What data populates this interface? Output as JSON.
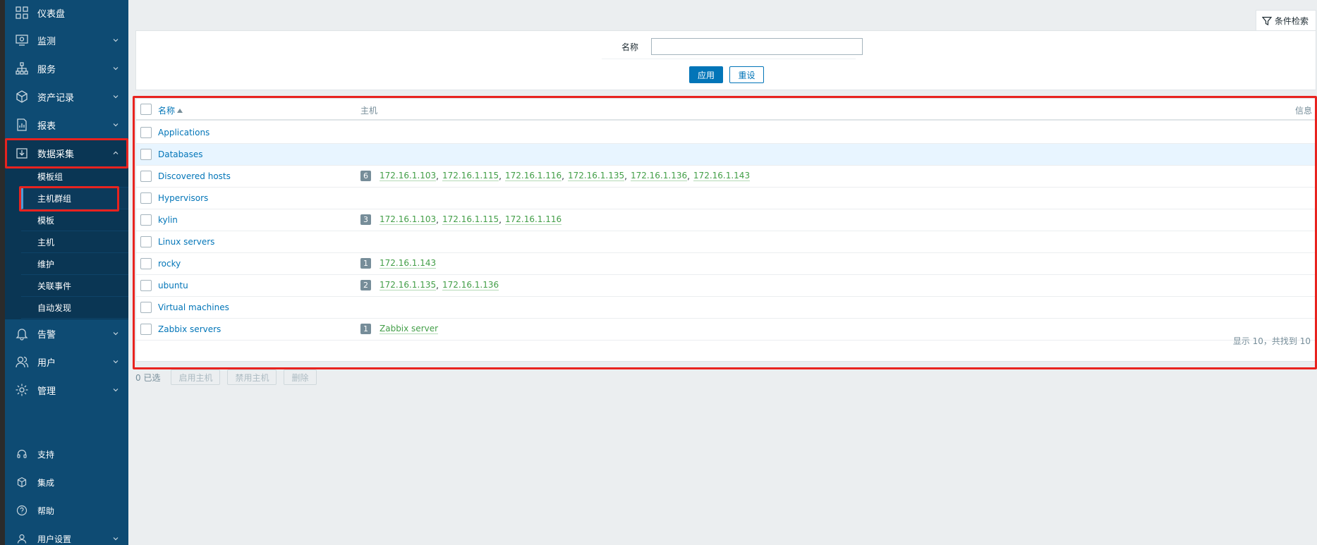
{
  "sidebar": {
    "items": [
      {
        "label": "仪表盘",
        "icon": "dashboard-icon"
      },
      {
        "label": "监测",
        "icon": "monitoring-icon"
      },
      {
        "label": "服务",
        "icon": "services-icon"
      },
      {
        "label": "资产记录",
        "icon": "inventory-icon"
      },
      {
        "label": "报表",
        "icon": "reports-icon"
      },
      {
        "label": "数据采集",
        "icon": "data-collection-icon"
      },
      {
        "label": "告警",
        "icon": "bell-icon"
      },
      {
        "label": "用户",
        "icon": "users-icon"
      },
      {
        "label": "管理",
        "icon": "gear-icon"
      }
    ],
    "submenu": [
      {
        "label": "模板组"
      },
      {
        "label": "主机群组"
      },
      {
        "label": "模板"
      },
      {
        "label": "主机"
      },
      {
        "label": "维护"
      },
      {
        "label": "关联事件"
      },
      {
        "label": "自动发现"
      }
    ],
    "bottom": [
      {
        "label": "支持",
        "icon": "headset-icon"
      },
      {
        "label": "集成",
        "icon": "integrations-icon"
      },
      {
        "label": "帮助",
        "icon": "help-icon"
      },
      {
        "label": "用户设置",
        "icon": "user-settings-icon"
      }
    ]
  },
  "filter": {
    "tab_label": "条件检索",
    "name_label": "名称",
    "name_value": "",
    "apply_label": "应用",
    "reset_label": "重设"
  },
  "table": {
    "headers": {
      "name": "名称",
      "hosts": "主机",
      "info": "信息"
    },
    "rows": [
      {
        "name": "Applications",
        "count": "",
        "hosts": []
      },
      {
        "name": "Databases",
        "count": "",
        "hosts": []
      },
      {
        "name": "Discovered hosts",
        "count": "6",
        "hosts": [
          "172.16.1.103",
          "172.16.1.115",
          "172.16.1.116",
          "172.16.1.135",
          "172.16.1.136",
          "172.16.1.143"
        ]
      },
      {
        "name": "Hypervisors",
        "count": "",
        "hosts": []
      },
      {
        "name": "kylin",
        "count": "3",
        "hosts": [
          "172.16.1.103",
          "172.16.1.115",
          "172.16.1.116"
        ]
      },
      {
        "name": "Linux servers",
        "count": "",
        "hosts": []
      },
      {
        "name": "rocky",
        "count": "1",
        "hosts": [
          "172.16.1.143"
        ]
      },
      {
        "name": "ubuntu",
        "count": "2",
        "hosts": [
          "172.16.1.135",
          "172.16.1.136"
        ]
      },
      {
        "name": "Virtual machines",
        "count": "",
        "hosts": []
      },
      {
        "name": "Zabbix servers",
        "count": "1",
        "hosts": [
          "Zabbix server"
        ]
      }
    ],
    "footer": "显示 10，共找到 10"
  },
  "actions": {
    "selected": "0 已选",
    "enable_hosts": "启用主机",
    "disable_hosts": "禁用主机",
    "delete": "删除"
  }
}
